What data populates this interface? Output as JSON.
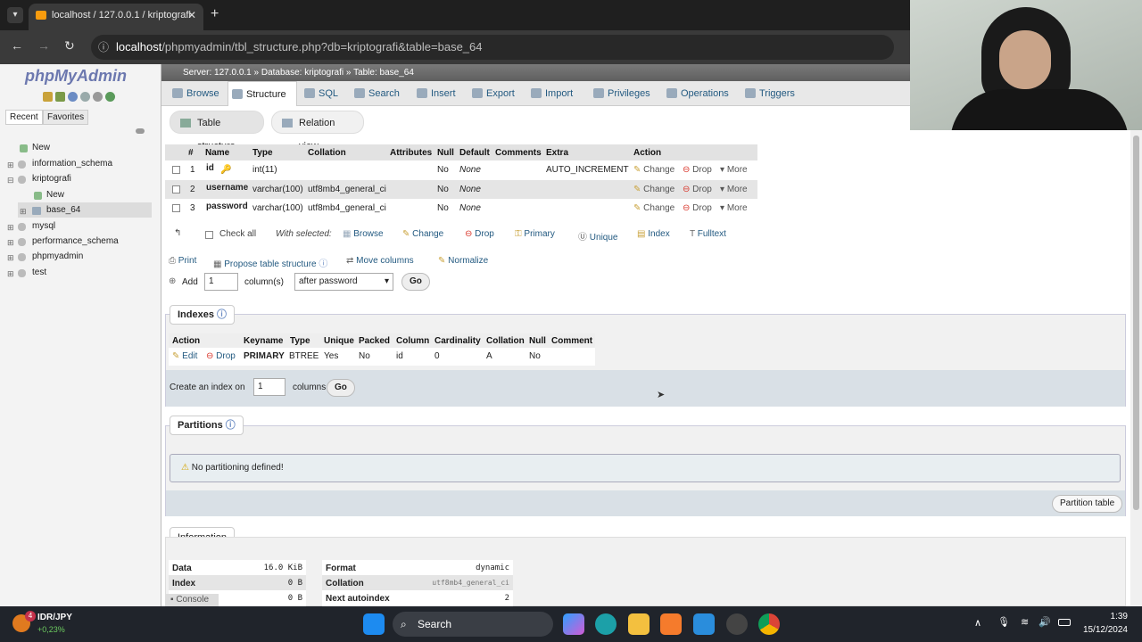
{
  "browser": {
    "tab_title": "localhost / 127.0.0.1 / kriptografi",
    "url_host": "localhost",
    "url_path": "/phpmyadmin/tbl_structure.php?db=kriptografi&table=base_64"
  },
  "sidebar": {
    "logo": "phpMyAdmin",
    "tabs": [
      "Recent",
      "Favorites"
    ],
    "tree": [
      "New",
      "information_schema",
      "kriptografi",
      "New",
      "base_64",
      "mysql",
      "performance_schema",
      "phpmyadmin",
      "test"
    ]
  },
  "breadcrumb": {
    "server": "Server: 127.0.0.1",
    "database": "Database: kriptografi",
    "table": "Table: base_64"
  },
  "topnav": [
    "Browse",
    "Structure",
    "SQL",
    "Search",
    "Insert",
    "Export",
    "Import",
    "Privileges",
    "Operations",
    "Triggers"
  ],
  "subtabs": [
    "Table structure",
    "Relation view"
  ],
  "columns_table": {
    "headers": [
      "#",
      "Name",
      "Type",
      "Collation",
      "Attributes",
      "Null",
      "Default",
      "Comments",
      "Extra",
      "Action"
    ],
    "rows": [
      {
        "num": "1",
        "name": "id",
        "type": "int(11)",
        "collation": "",
        "null": "No",
        "default": "None",
        "extra": "AUTO_INCREMENT"
      },
      {
        "num": "2",
        "name": "username",
        "type": "varchar(100)",
        "collation": "utf8mb4_general_ci",
        "null": "No",
        "default": "None",
        "extra": ""
      },
      {
        "num": "3",
        "name": "password",
        "type": "varchar(100)",
        "collation": "utf8mb4_general_ci",
        "null": "No",
        "default": "None",
        "extra": ""
      }
    ],
    "actions": [
      "Change",
      "Drop",
      "More"
    ]
  },
  "bulk": {
    "check_all": "Check all",
    "with_selected": "With selected:",
    "actions": [
      "Browse",
      "Change",
      "Drop",
      "Primary",
      "Unique",
      "Index",
      "Fulltext"
    ]
  },
  "tools": [
    "Print",
    "Propose table structure",
    "Move columns",
    "Normalize"
  ],
  "add_column": {
    "label": "Add",
    "value": "1",
    "suffix": "column(s)",
    "position": "after password",
    "go": "Go"
  },
  "indexes": {
    "legend": "Indexes",
    "headers": [
      "Action",
      "Keyname",
      "Type",
      "Unique",
      "Packed",
      "Column",
      "Cardinality",
      "Collation",
      "Null",
      "Comment"
    ],
    "row": {
      "edit": "Edit",
      "drop": "Drop",
      "keyname": "PRIMARY",
      "type": "BTREE",
      "unique": "Yes",
      "packed": "No",
      "column": "id",
      "cardinality": "0",
      "collation": "A",
      "null": "No"
    },
    "create_label": "Create an index on",
    "create_value": "1",
    "create_suffix": "columns",
    "go": "Go"
  },
  "partitions": {
    "legend": "Partitions",
    "message": "No partitioning defined!",
    "button": "Partition table"
  },
  "information": {
    "legend": "Information",
    "left": [
      {
        "label": "Data",
        "value": "16.0 KiB"
      },
      {
        "label": "Index",
        "value": "0 B"
      },
      {
        "label": "Console",
        "value": "0 B"
      }
    ],
    "right": [
      {
        "label": "Format",
        "value": "dynamic"
      },
      {
        "label": "Collation",
        "value": "utf8mb4_general_ci"
      },
      {
        "label": "Next autoindex",
        "value": "2"
      }
    ]
  },
  "taskbar": {
    "ticker": "IDR/JPY",
    "ticker_change": "+0,23%",
    "badge": "4",
    "search": "Search",
    "time": "1:39",
    "date": "15/12/2024"
  },
  "colors": {
    "accent": "#235a81",
    "logo_blue": "#6c78af",
    "logo_orange": "#f89c0e",
    "drop_red": "#d9362b"
  }
}
